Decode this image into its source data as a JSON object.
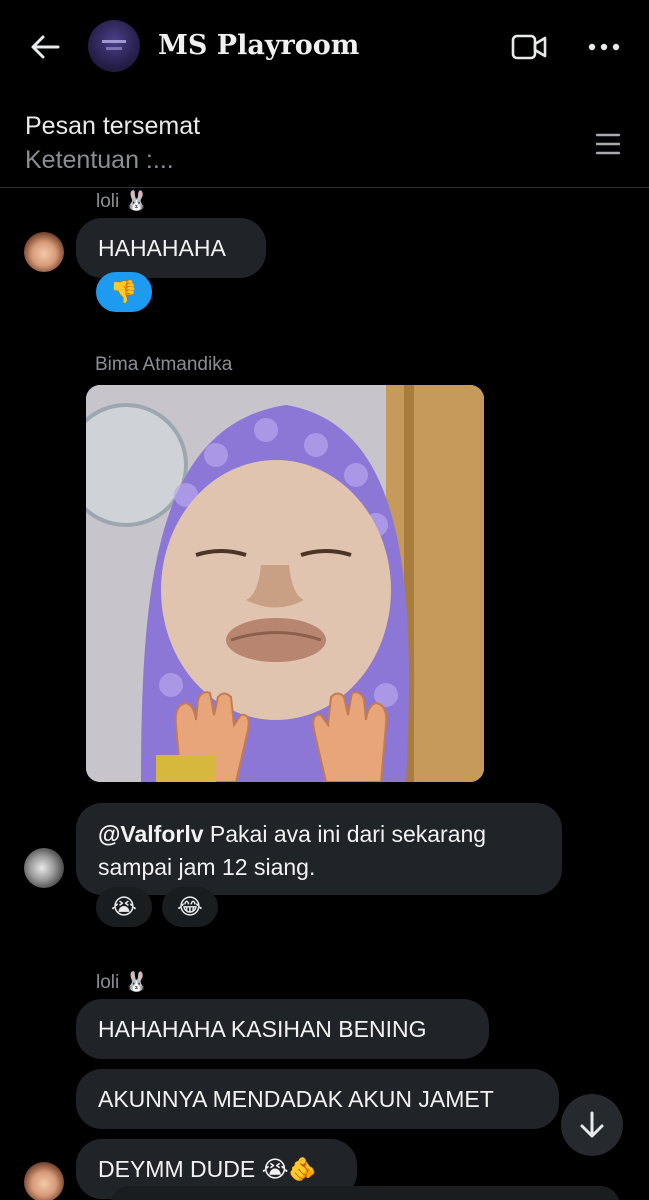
{
  "header": {
    "title": "MS Playroom",
    "back_icon": "arrow-left-icon",
    "video_icon": "video-camera-icon",
    "more_icon": "more-horizontal-icon",
    "avatar_icon": "group-avatar-image"
  },
  "pinned": {
    "title": "Pesan tersemat",
    "preview": "Ketentuan :...",
    "menu_icon": "list-icon"
  },
  "messages": [
    {
      "sender": "loli",
      "sender_emoji": "🐰",
      "text": "HAHAHAHA",
      "reactions": [
        "👎"
      ],
      "reaction_active": true
    },
    {
      "sender": "Bima Atmandika",
      "type": "image",
      "image_desc_icon": "photo-image"
    },
    {
      "mention": "@Valforlv",
      "text": " Pakai ava ini dari sekarang sampai jam 12 siang.",
      "reactions": [
        "😭",
        "😂"
      ]
    },
    {
      "sender": "loli",
      "sender_emoji": "🐰",
      "text": "HAHAHAHA KASIHAN BENING"
    },
    {
      "text": "AKUNNYA MENDADAK AKUN JAMET"
    },
    {
      "text": "DEYMM DUDE",
      "emoji": "😭🫵"
    }
  ],
  "scroll_icon": "arrow-down-icon",
  "colors": {
    "background": "#000000",
    "bubble": "#202327",
    "accent": "#1d9bf0",
    "muted": "#8b8f94"
  }
}
